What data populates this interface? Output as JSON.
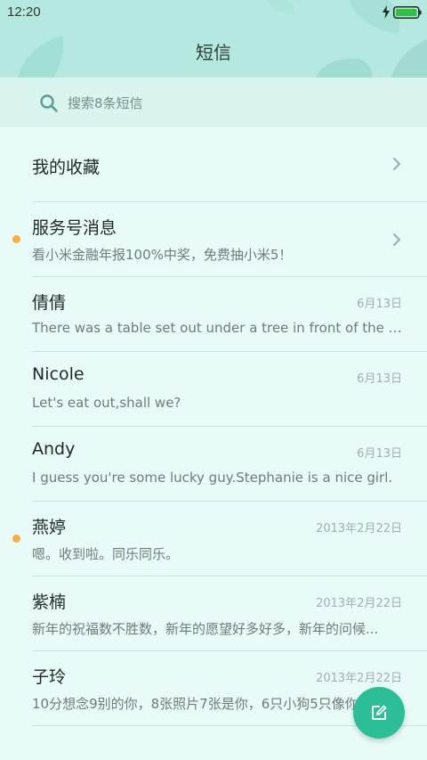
{
  "status_bar": {
    "time": "12:20"
  },
  "header": {
    "title": "短信"
  },
  "search": {
    "placeholder": "搜索8条短信"
  },
  "favorites": {
    "label": "我的收藏"
  },
  "conversations": [
    {
      "name": "服务号消息",
      "snippet": "看小米金融年报100%中奖，免费抽小米5！",
      "date": "",
      "unread": true,
      "has_chevron": true
    },
    {
      "name": "倩倩",
      "snippet": "There was a table set out under a tree in front of the ho...",
      "date": "6月13日",
      "unread": false,
      "has_chevron": false
    },
    {
      "name": "Nicole",
      "snippet": "Let's eat out,shall we?",
      "date": "6月13日",
      "unread": false,
      "has_chevron": false
    },
    {
      "name": "Andy",
      "snippet": "I guess you're some lucky guy.Stephanie is a nice girl.",
      "date": "6月13日",
      "unread": false,
      "has_chevron": false
    },
    {
      "name": "燕婷",
      "snippet": "嗯。收到啦。同乐同乐。",
      "date": "2013年2月22日",
      "unread": true,
      "has_chevron": false
    },
    {
      "name": "紫楠",
      "snippet": "新年的祝福数不胜数，新年的愿望好多好多，新年的问候...",
      "date": "2013年2月22日",
      "unread": false,
      "has_chevron": false
    },
    {
      "name": "子玲",
      "snippet": "10分想念9别的你，8张照片7张是你，6只小狗5只像你",
      "date": "2013年2月22日",
      "unread": false,
      "has_chevron": false
    }
  ],
  "icons": {
    "search": "search-icon",
    "chevron": "chevron-right-icon",
    "compose": "compose-icon",
    "battery": "battery-icon",
    "charge": "charging-bolt-icon"
  },
  "colors": {
    "accent": "#2bbf98",
    "unread_dot": "#f6b13c",
    "header_bg": "#b5e9df",
    "background": "#e8fbf6"
  }
}
